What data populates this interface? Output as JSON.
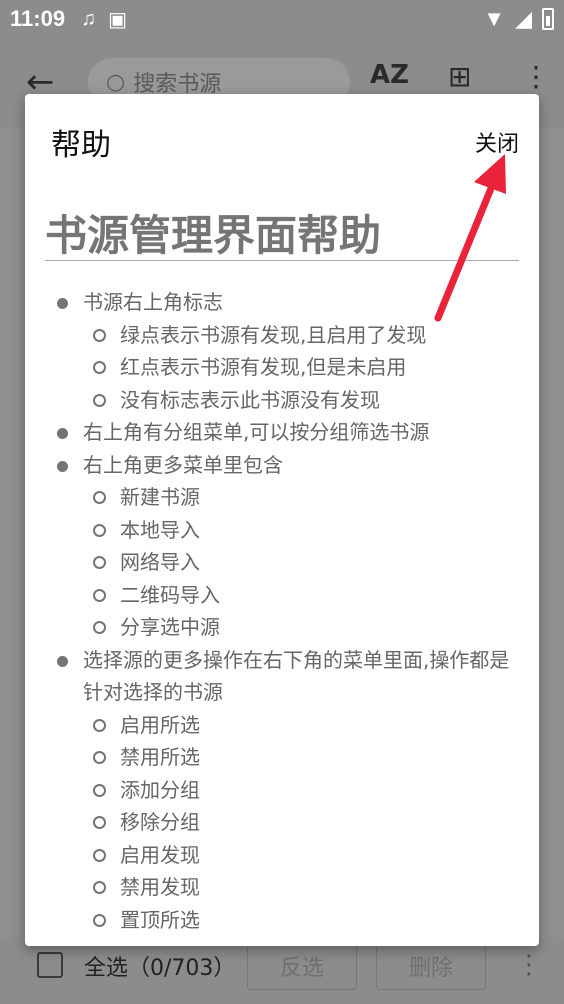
{
  "status_bar": {
    "time": "11:09"
  },
  "app_bar": {
    "search_placeholder": "搜索书源",
    "sort_label": "AZ"
  },
  "bottom_bar": {
    "select_all": "全选（0/703）",
    "invert": "反选",
    "delete": "删除"
  },
  "dialog": {
    "title": "帮助",
    "close": "关闭",
    "heading": "书源管理界面帮助",
    "items": [
      {
        "text": "书源右上角标志",
        "sub": [
          "绿点表示书源有发现,且启用了发现",
          "红点表示书源有发现,但是未启用",
          "没有标志表示此书源没有发现"
        ]
      },
      {
        "text": "右上角有分组菜单,可以按分组筛选书源",
        "sub": []
      },
      {
        "text": "右上角更多菜单里包含",
        "sub": [
          "新建书源",
          "本地导入",
          "网络导入",
          "二维码导入",
          "分享选中源"
        ]
      },
      {
        "text": "选择源的更多操作在右下角的菜单里面,操作都是针对选择的书源",
        "sub": [
          "启用所选",
          "禁用所选",
          "添加分组",
          "移除分组",
          "启用发现",
          "禁用发现",
          "置顶所选"
        ]
      }
    ]
  },
  "colors": {
    "annotation_arrow": "#e8233a",
    "scrim": "#8c8c8c"
  }
}
